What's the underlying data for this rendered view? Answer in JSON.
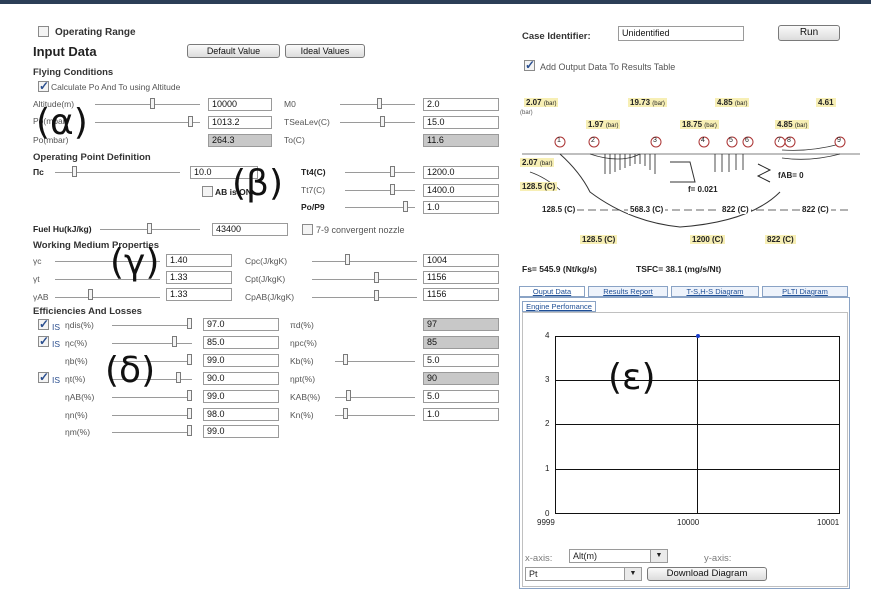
{
  "top": {
    "operating_range": "Operating Range",
    "input_data_title": "Input Data",
    "default_button": "Default Value",
    "ideal_button": "Ideal Values"
  },
  "flying": {
    "title": "Flying Conditions",
    "calc_label": "Calculate Po And To using Altitude",
    "alt_label": "Altitude(m)",
    "alt_value": "10000",
    "po_label": "Po(mbar)",
    "po_value": "1013.2",
    "po2_label": "Po(mbar)",
    "po2_value": "264.3",
    "m0_label": "M0",
    "m0_value": "2.0",
    "tsea_label": "TSeaLev(C)",
    "tsea_value": "15.0",
    "to_label": "To(C)",
    "to_value": "11.6"
  },
  "operating_point": {
    "title": "Operating Point Definition",
    "pic_label": "Πc",
    "pic_value": "10.0",
    "ab_label": "AB is ON",
    "t14_label": "Tt4(C)",
    "t14_value": "1200.0",
    "t17_label": "Tt7(C)",
    "t17_value": "1400.0",
    "po_p9_label": "Po/P9",
    "po_p9_value": "1.0",
    "fuel_label": "Fuel Hu(kJ/kg)",
    "fuel_value": "43400",
    "nozzle_label": "7-9 convergent nozzle"
  },
  "medium": {
    "title": "Working Medium Properties",
    "gc_label": "γc",
    "gc_value": "1.40",
    "gt_label": "γt",
    "gt_value": "1.33",
    "gab_label": "γAB",
    "gab_value": "1.33",
    "cpc_label": "Cpc(J/kgK)",
    "cpc_value": "1004",
    "cpt_label": "Cpt(J/kgK)",
    "cpt_value": "1156",
    "cpab_label": "CpAB(J/kgK)",
    "cpab_value": "1156"
  },
  "efficiencies": {
    "title": "Efficiencies And Losses",
    "is_label": "IS",
    "ndis_label": "ηdis(%)",
    "ndis_value": "97.0",
    "nc_label": "ηc(%)",
    "nc_value": "85.0",
    "nb_label": "ηb(%)",
    "nb_value": "99.0",
    "nt_label": "ηt(%)",
    "nt_value": "90.0",
    "nab_label": "ηAB(%)",
    "nab_value": "99.0",
    "nn_label": "ηn(%)",
    "nn_value": "98.0",
    "nm_label": "ηm(%)",
    "nm_value": "99.0",
    "rd_label": "πd(%)",
    "rd_value": "97",
    "npc_label": "ηpc(%)",
    "npc_value": "85",
    "kb_label": "Kb(%)",
    "kb_value": "5.0",
    "npt_label": "ηpt(%)",
    "npt_value": "90",
    "kab_label": "KAB(%)",
    "kab_value": "5.0",
    "kn_label": "Kn(%)",
    "kn_value": "1.0"
  },
  "greek": {
    "alpha": "(α)",
    "beta": "(β)",
    "gamma": "(γ)",
    "delta": "(δ)",
    "epsilon": "(ε)"
  },
  "right": {
    "case_label": "Case Identifier:",
    "case_value": "Unidentified",
    "run_button": "Run",
    "add_output_label": "Add Output Data To Results Table"
  },
  "diagram": {
    "p_top": [
      "2.07",
      "19.73",
      "4.85",
      "4.61"
    ],
    "p_mid": [
      "1.97",
      "18.75",
      "4.85"
    ],
    "bar_unit": "(bar)",
    "p_left": "2.07",
    "t_left": "128.5 (C)",
    "f_text": "f= 0.021",
    "fab_text": "fAB= 0",
    "t_row": [
      "128.5 (C)",
      "568.3 (C)",
      "822 (C)",
      "822 (C)"
    ],
    "t_bottom": [
      "128.5 (C)",
      "1200 (C)",
      "822 (C)"
    ],
    "stations": [
      "1",
      "2",
      "3",
      "4",
      "5",
      "6",
      "7",
      "8",
      "9"
    ],
    "fs_text": "Fs= 545.9 (Nt/kg/s)",
    "tsfc_text": "TSFC= 38.1 (mg/s/Nt)"
  },
  "tabs": [
    "Ouput Data",
    "Results Report",
    "T-S,H-S Diagram",
    "PLTI Diagram"
  ],
  "subtab": "Engine Perfomance",
  "plot": {
    "y_ticks": [
      "0",
      "1",
      "2",
      "3",
      "4"
    ],
    "x_ticks": [
      "9999",
      "10000",
      "10001"
    ],
    "xaxis_label": "x-axis:",
    "xaxis_value": "Alt(m)",
    "yaxis_label": "y-axis:",
    "yaxis_value": "Pt",
    "download_button": "Download Diagram",
    "point_color": "#1a3dcc"
  },
  "chart_data": {
    "type": "scatter",
    "xlim": [
      9999,
      10001
    ],
    "ylim": [
      0,
      4
    ],
    "x": [
      10000
    ],
    "y": [
      4
    ]
  }
}
